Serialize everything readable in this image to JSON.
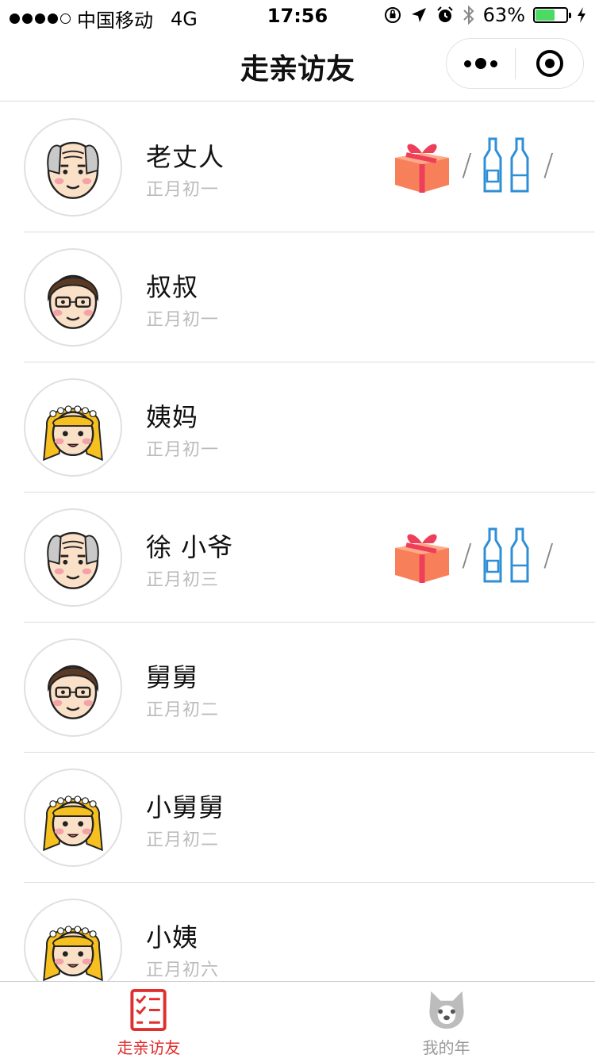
{
  "status_bar": {
    "carrier": "中国移动",
    "network": "4G",
    "time": "17:56",
    "battery": "63%",
    "battery_level": 0.63
  },
  "nav": {
    "title": "走亲访友"
  },
  "rows": [
    {
      "name": "老丈人",
      "date": "正月初一",
      "avatar": "old-man-icon",
      "has_gifts": true
    },
    {
      "name": "叔叔",
      "date": "正月初一",
      "avatar": "man-glasses-icon",
      "has_gifts": false
    },
    {
      "name": "姨妈",
      "date": "正月初一",
      "avatar": "girl-flower-crown-icon",
      "has_gifts": false
    },
    {
      "name": "徐 小爷",
      "date": "正月初三",
      "avatar": "old-man-icon",
      "has_gifts": true
    },
    {
      "name": "舅舅",
      "date": "正月初二",
      "avatar": "man-glasses-icon",
      "has_gifts": false
    },
    {
      "name": "小舅舅",
      "date": "正月初二",
      "avatar": "girl-flower-crown-icon",
      "has_gifts": false
    },
    {
      "name": "小姨",
      "date": "正月初六",
      "avatar": "girl-flower-crown-icon",
      "has_gifts": false
    }
  ],
  "gift_separator": "/",
  "tabbar": {
    "tabs": [
      {
        "label": "走亲访友",
        "icon": "checklist-icon",
        "active": true
      },
      {
        "label": "我的年",
        "icon": "dog-face-icon",
        "active": false
      }
    ]
  },
  "colors": {
    "accent": "#e02e2e",
    "gift_box": "#f7805a",
    "gift_ribbon": "#ee3f5a",
    "bottle": "#2e8fd6"
  }
}
